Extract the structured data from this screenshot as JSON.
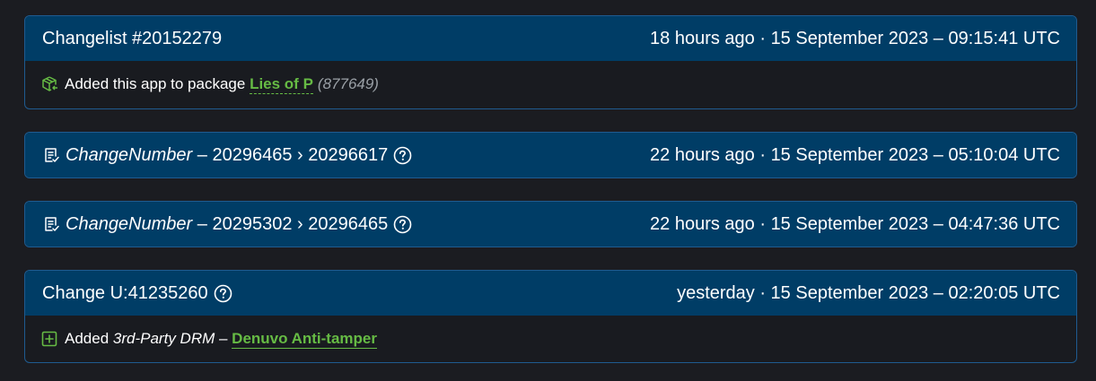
{
  "entries": [
    {
      "title": "Changelist #20152279",
      "time": "18 hours ago · 15 September 2023 – 09:15:41 UTC",
      "detail": {
        "prefix": "Added this app to package",
        "link": "Lies of P",
        "suffix": "(877649)"
      }
    },
    {
      "key": "ChangeNumber",
      "sep": " – ",
      "value": "20296465 › 20296617",
      "time": "22 hours ago · 15 September 2023 – 05:10:04 UTC"
    },
    {
      "key": "ChangeNumber",
      "sep": " – ",
      "value": "20295302 › 20296465",
      "time": "22 hours ago · 15 September 2023 – 04:47:36 UTC"
    },
    {
      "title": "Change U:41235260",
      "time": "yesterday · 15 September 2023 – 02:20:05 UTC",
      "detail": {
        "prefix": "Added",
        "category": "3rd-Party DRM",
        "sep": " – ",
        "link": "Denuvo Anti-tamper"
      }
    }
  ],
  "icons": {
    "package": "package-icon",
    "changelog": "document-check-icon",
    "help": "question-circle-icon",
    "add": "plus-square-icon"
  },
  "colors": {
    "header_bg": "#003d66",
    "card_border": "#1f5b90",
    "link_green": "#66bb44",
    "page_bg": "#1b1c21"
  }
}
